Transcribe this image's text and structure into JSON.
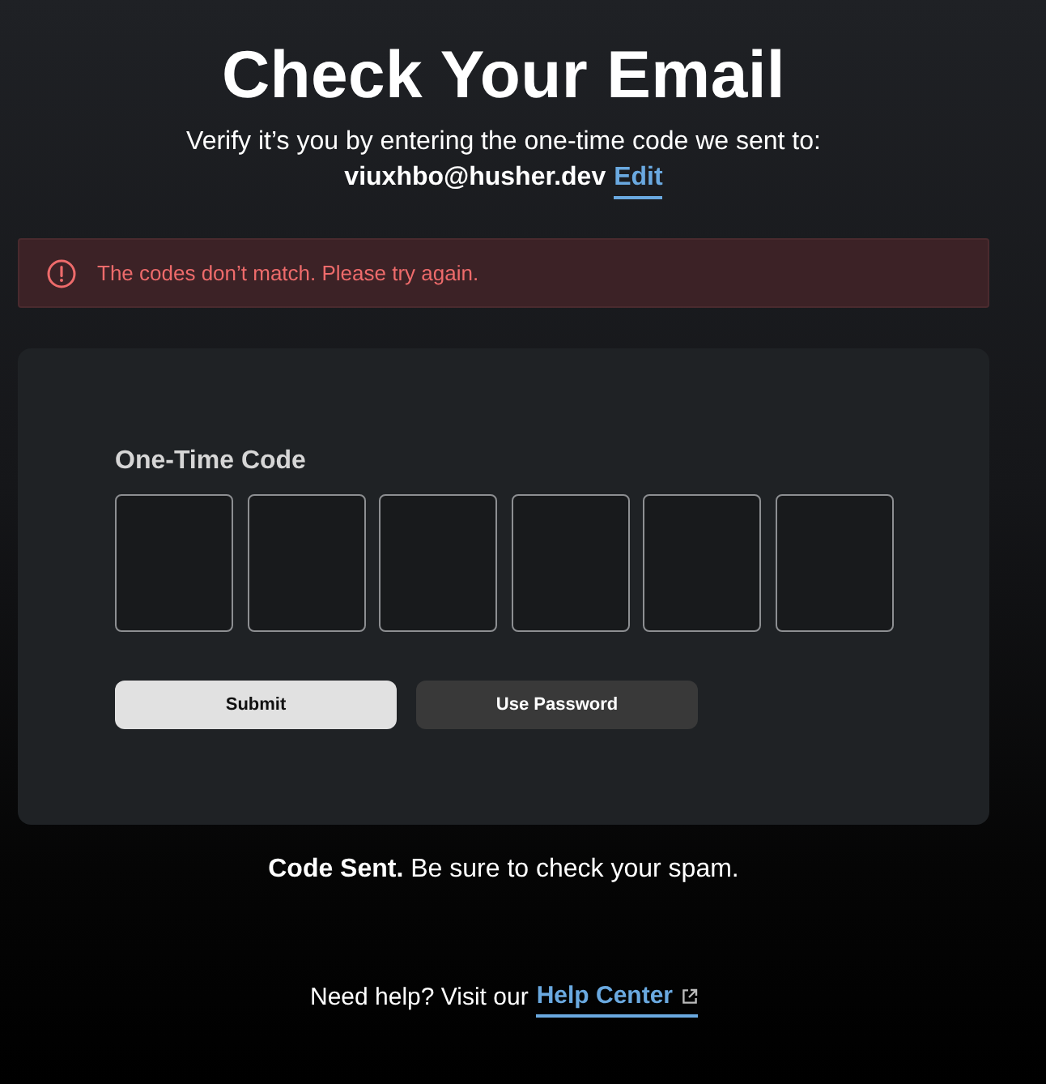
{
  "header": {
    "title": "Check Your Email",
    "subtitle": "Verify it’s you by entering the one-time code we sent to:",
    "email": "viuxhbo@husher.dev",
    "edit_link": "Edit"
  },
  "alert": {
    "kind": "error",
    "message": "The codes don’t match. Please try again."
  },
  "code_form": {
    "label": "One-Time Code",
    "fields": [
      {
        "kind": "digit"
      },
      {
        "kind": "digit"
      },
      {
        "kind": "digit"
      },
      {
        "kind": "digit"
      },
      {
        "kind": "digit"
      },
      {
        "kind": "digit"
      }
    ],
    "buttons": [
      {
        "label": "Submit",
        "kind": "primary"
      },
      {
        "label": "Use Password",
        "kind": "secondary"
      }
    ]
  },
  "footer": {
    "notice": "**Code Sent.** Be sure to check your spam.",
    "help_text": "Need help? Visit our",
    "help_link": "Help Center"
  }
}
